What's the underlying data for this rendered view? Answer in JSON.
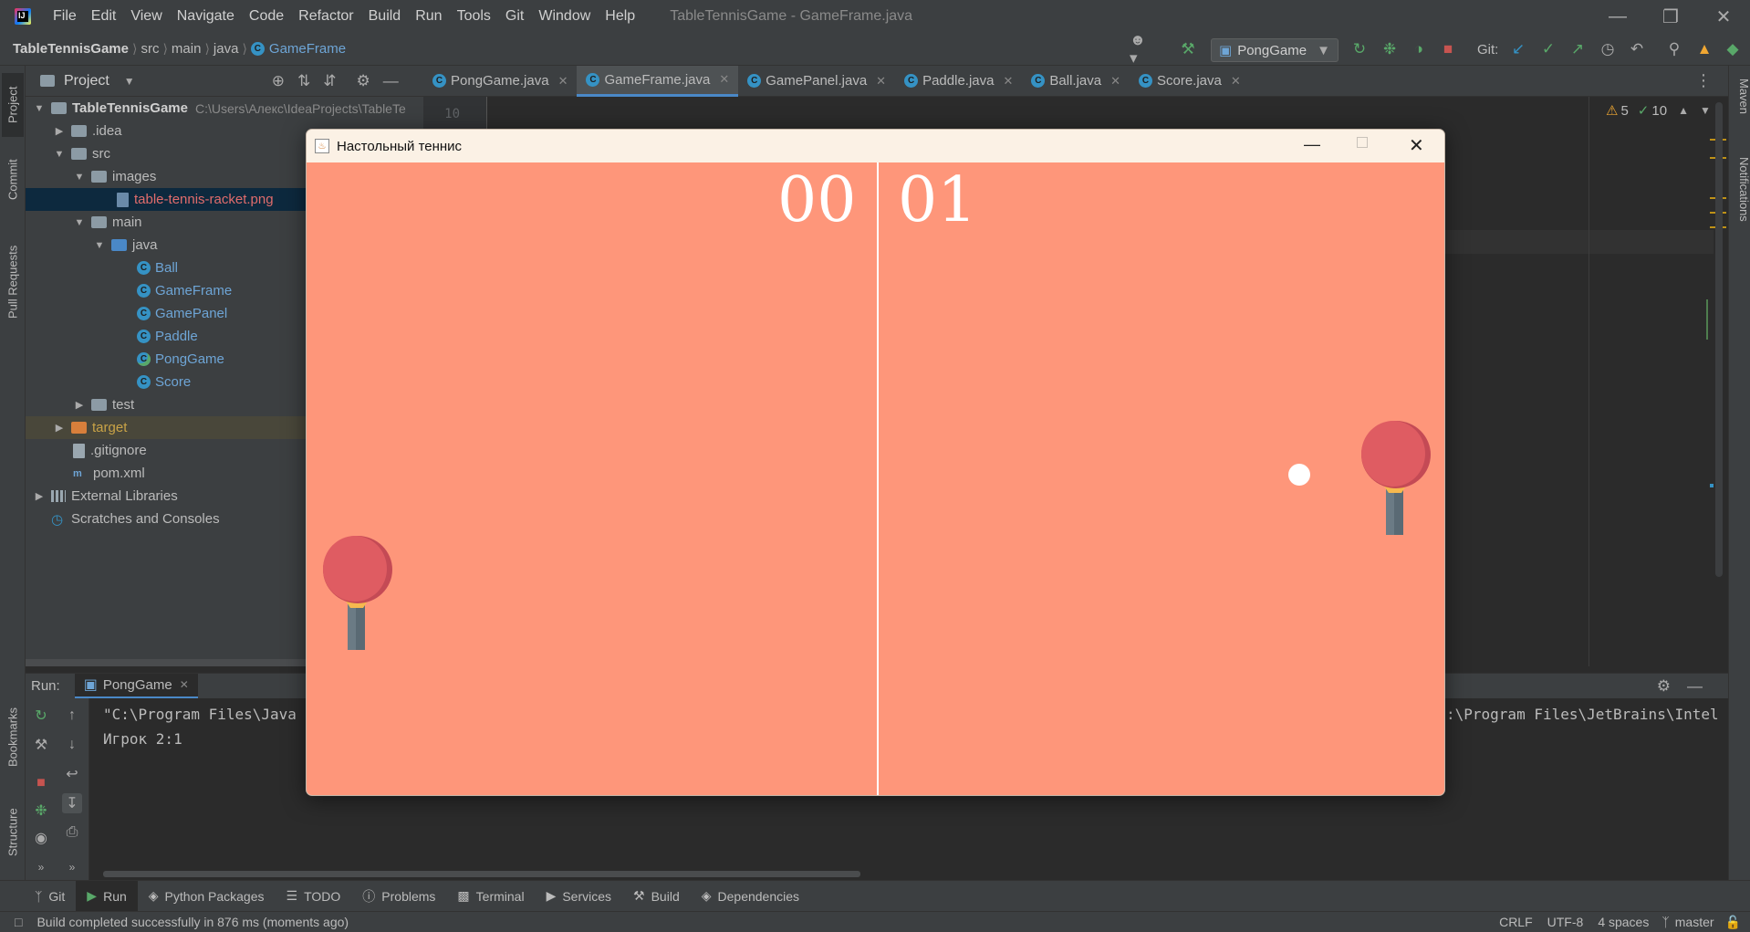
{
  "menu": [
    "File",
    "Edit",
    "View",
    "Navigate",
    "Code",
    "Refactor",
    "Build",
    "Run",
    "Tools",
    "Git",
    "Window",
    "Help"
  ],
  "window_title": "TableTennisGame - GameFrame.java",
  "breadcrumb": {
    "project": "TableTennisGame",
    "parts": [
      "src",
      "main",
      "java"
    ],
    "current": "GameFrame"
  },
  "run_config": "PongGame",
  "git_label": "Git:",
  "left_stripe": {
    "project": "Project",
    "commit": "Commit",
    "pull_requests": "Pull Requests",
    "bookmarks": "Bookmarks",
    "structure": "Structure"
  },
  "right_stripe": {
    "maven": "Maven",
    "notifications": "Notifications"
  },
  "project_panel": {
    "title": "Project",
    "tree": [
      {
        "label": "TableTennisGame",
        "path": "C:\\Users\\Алекс\\IdeaProjects\\TableTe",
        "bold": true
      },
      {
        "label": ".idea"
      },
      {
        "label": "src"
      },
      {
        "label": "images"
      },
      {
        "label": "table-tennis-racket.png"
      },
      {
        "label": "main"
      },
      {
        "label": "java"
      },
      {
        "label": "Ball"
      },
      {
        "label": "GameFrame"
      },
      {
        "label": "GamePanel"
      },
      {
        "label": "Paddle"
      },
      {
        "label": "PongGame"
      },
      {
        "label": "Score"
      },
      {
        "label": "test"
      },
      {
        "label": "target"
      },
      {
        "label": ".gitignore"
      },
      {
        "label": "pom.xml"
      },
      {
        "label": "External Libraries"
      },
      {
        "label": "Scratches and Consoles"
      }
    ]
  },
  "editor_tabs": [
    "PongGame.java",
    "GameFrame.java",
    "GamePanel.java",
    "Paddle.java",
    "Ball.java",
    "Score.java"
  ],
  "active_tab": 1,
  "editor": {
    "line_number": "10",
    "warnings": "5",
    "checks": "10"
  },
  "run_panel": {
    "label": "Run:",
    "tab": "PongGame",
    "lines": [
      "\"C:\\Program Files\\Java",
      "Игрок 2:1"
    ],
    "line_right": ":\\Program Files\\JetBrains\\Intel"
  },
  "tool_tabs": [
    "Git",
    "Run",
    "Python Packages",
    "TODO",
    "Problems",
    "Terminal",
    "Services",
    "Build",
    "Dependencies"
  ],
  "status": {
    "message": "Build completed successfully in 876 ms (moments ago)",
    "line_sep": "CRLF",
    "encoding": "UTF-8",
    "indent": "4 spaces",
    "branch": "master"
  },
  "game": {
    "title": "Настольный теннис",
    "score_left": "00",
    "score_right": "01",
    "bg_color": "#fe967a"
  }
}
